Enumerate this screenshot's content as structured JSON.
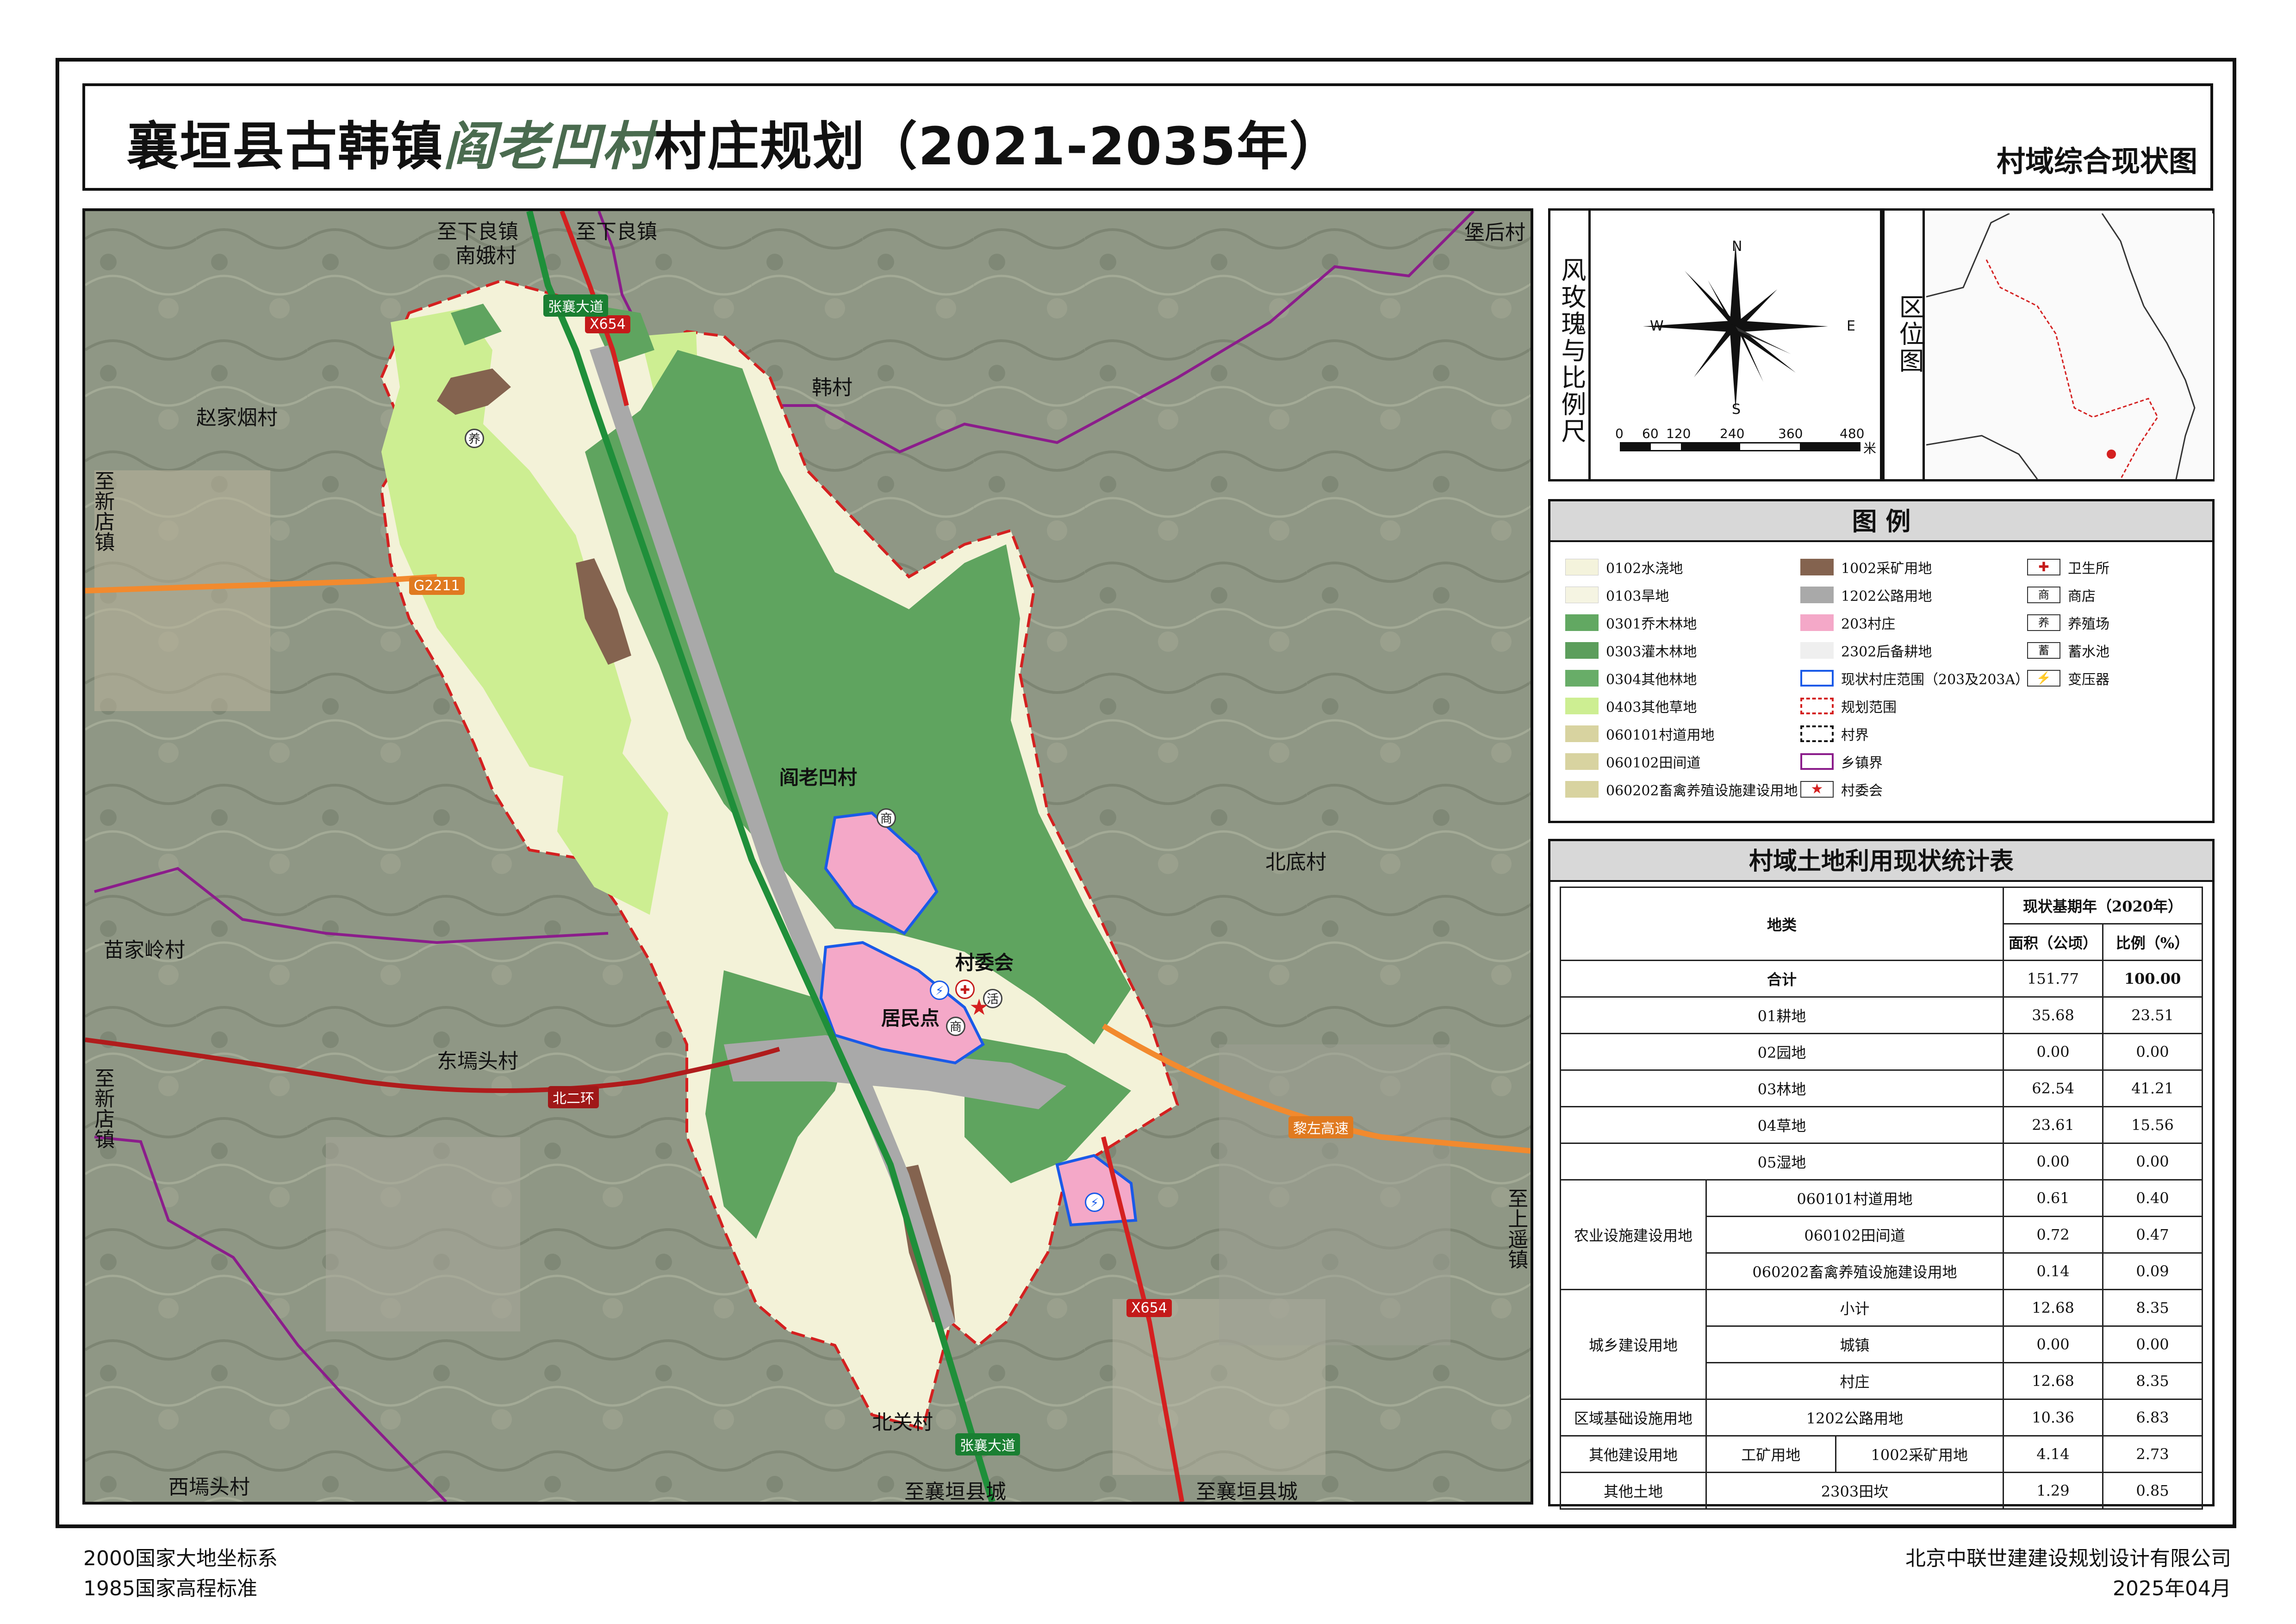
{
  "title": {
    "prefix": "襄垣县古韩镇",
    "village": "阎老凹村",
    "suffix": "村庄规划（2021-2035年）",
    "subtitle": "村域综合现状图"
  },
  "map": {
    "labels": {
      "north_road_1": "至下良镇",
      "north_road_2": "至下良镇",
      "nan_e": "南娥村",
      "baohou": "堡后村",
      "hancun": "韩村",
      "zhaojiayan": "赵家烟村",
      "to_xindian_1": "至新店镇",
      "to_xindian_2": "至新店镇",
      "village": "阎老凹村",
      "beidi": "北底村",
      "miaojialing": "苗家岭村",
      "dongyuantou": "东墕头村",
      "committee": "村委会",
      "settlement": "居民点",
      "to_shangsui": "至上遥镇",
      "beiguan": "北关村",
      "xiyuantou": "西墕头村",
      "to_xiangyuan_1": "至襄垣县城",
      "to_xiangyuan_2": "至襄垣县城"
    },
    "road_tags": {
      "g2211": "G2211",
      "x654_top": "X654",
      "x654_bottom": "X654",
      "beierhuan": "北二环",
      "xiangyuan_exp": "黎左高速",
      "zhangxiang_top": "张襄大道",
      "zhangxiang_bottom": "张襄大道"
    },
    "poi": {
      "farm": "养",
      "store_top": "商",
      "store_bottom": "商",
      "activity": "活"
    }
  },
  "compass": {
    "n": "N",
    "s": "S",
    "e": "E",
    "w": "W",
    "panel_label": "风玫瑰与比例尺",
    "scale_ticks": [
      "0",
      "60",
      "120",
      "240",
      "360",
      "480"
    ],
    "scale_unit": "米"
  },
  "location_panel": {
    "label": "区位图"
  },
  "legend": {
    "title": "图    例",
    "items": [
      {
        "label": "0102水浇地",
        "color": "#f4f3dc"
      },
      {
        "label": "0103旱地",
        "color": "#f5f4e2"
      },
      {
        "label": "0301乔木林地",
        "color": "#62a862"
      },
      {
        "label": "0303灌木林地",
        "color": "#5c9e5c"
      },
      {
        "label": "0304其他林地",
        "color": "#68ad68"
      },
      {
        "label": "0403其他草地",
        "color": "#cdee92"
      },
      {
        "label": "060101村道用地",
        "color": "#d8d3a0"
      },
      {
        "label": "060102田间道",
        "color": "#d8d3a0"
      },
      {
        "label": "060202畜禽养殖设施建设用地",
        "color": "#d8d3a0"
      },
      {
        "label": "1002采矿用地",
        "color": "#84634f"
      },
      {
        "label": "1202公路用地",
        "color": "#a9a9a9"
      },
      {
        "label": "203村庄",
        "color": "#f4a8c8"
      },
      {
        "label": "2302后备耕地",
        "color": "#efefef"
      },
      {
        "label": "现状村庄范围（203及203A）",
        "color": "blue-outline"
      },
      {
        "label": "规划范围",
        "color": "red-dash"
      },
      {
        "label": "村界",
        "color": "black-dash"
      },
      {
        "label": "乡镇界",
        "color": "purple-outline"
      },
      {
        "label": "村委会",
        "color": "star"
      },
      {
        "label": "卫生所",
        "color": "cross"
      },
      {
        "label": "商店",
        "color": "store"
      },
      {
        "label": "养殖场",
        "color": "farm"
      },
      {
        "label": "蓄水池",
        "color": "pool"
      },
      {
        "label": "变压器",
        "color": "transformer"
      }
    ],
    "icon_glyphs": {
      "store": "商",
      "farm": "养",
      "pool": "蓄",
      "transformer": "⚡",
      "cross": "✚",
      "star": "★"
    }
  },
  "stats": {
    "title": "村域土地利用现状统计表",
    "head_category": "地类",
    "head_period": "现状基期年（2020年）",
    "head_area": "面积（公顷）",
    "head_ratio": "比例（%）",
    "rows": {
      "total": {
        "name": "合计",
        "area": "151.77",
        "ratio": "100.00"
      },
      "farmland": {
        "name": "01耕地",
        "area": "35.68",
        "ratio": "23.51"
      },
      "garden": {
        "name": "02园地",
        "area": "0.00",
        "ratio": "0.00"
      },
      "forest": {
        "name": "03林地",
        "area": "62.54",
        "ratio": "41.21"
      },
      "grass": {
        "name": "04草地",
        "area": "23.61",
        "ratio": "15.56"
      },
      "wetland": {
        "name": "05湿地",
        "area": "0.00",
        "ratio": "0.00"
      },
      "agri_group": "农业设施建设用地",
      "village_road": {
        "name": "060101村道用地",
        "area": "0.61",
        "ratio": "0.40"
      },
      "field_road": {
        "name": "060102田间道",
        "area": "0.72",
        "ratio": "0.47"
      },
      "livestock": {
        "name": "060202畜禽养殖设施建设用地",
        "area": "0.14",
        "ratio": "0.09"
      },
      "urban_group": "城乡建设用地",
      "subtotal": {
        "name": "小计",
        "area": "12.68",
        "ratio": "8.35"
      },
      "town": {
        "name": "城镇",
        "area": "0.00",
        "ratio": "0.00"
      },
      "village": {
        "name": "村庄",
        "area": "12.68",
        "ratio": "8.35"
      },
      "infra": {
        "group": "区域基础设施用地",
        "name": "1202公路用地",
        "area": "10.36",
        "ratio": "6.83"
      },
      "other_build": {
        "group": "其他建设用地",
        "sub": "工矿用地",
        "name": "1002采矿用地",
        "area": "4.14",
        "ratio": "2.73"
      },
      "other_land": {
        "group": "其他土地",
        "name": "2303田坎",
        "area": "1.29",
        "ratio": "0.85"
      }
    }
  },
  "footer": {
    "coord": "2000国家大地坐标系",
    "elev": "1985国家高程标准",
    "company": "北京中联世建建设规划设计有限公司",
    "date": "2025年04月"
  }
}
